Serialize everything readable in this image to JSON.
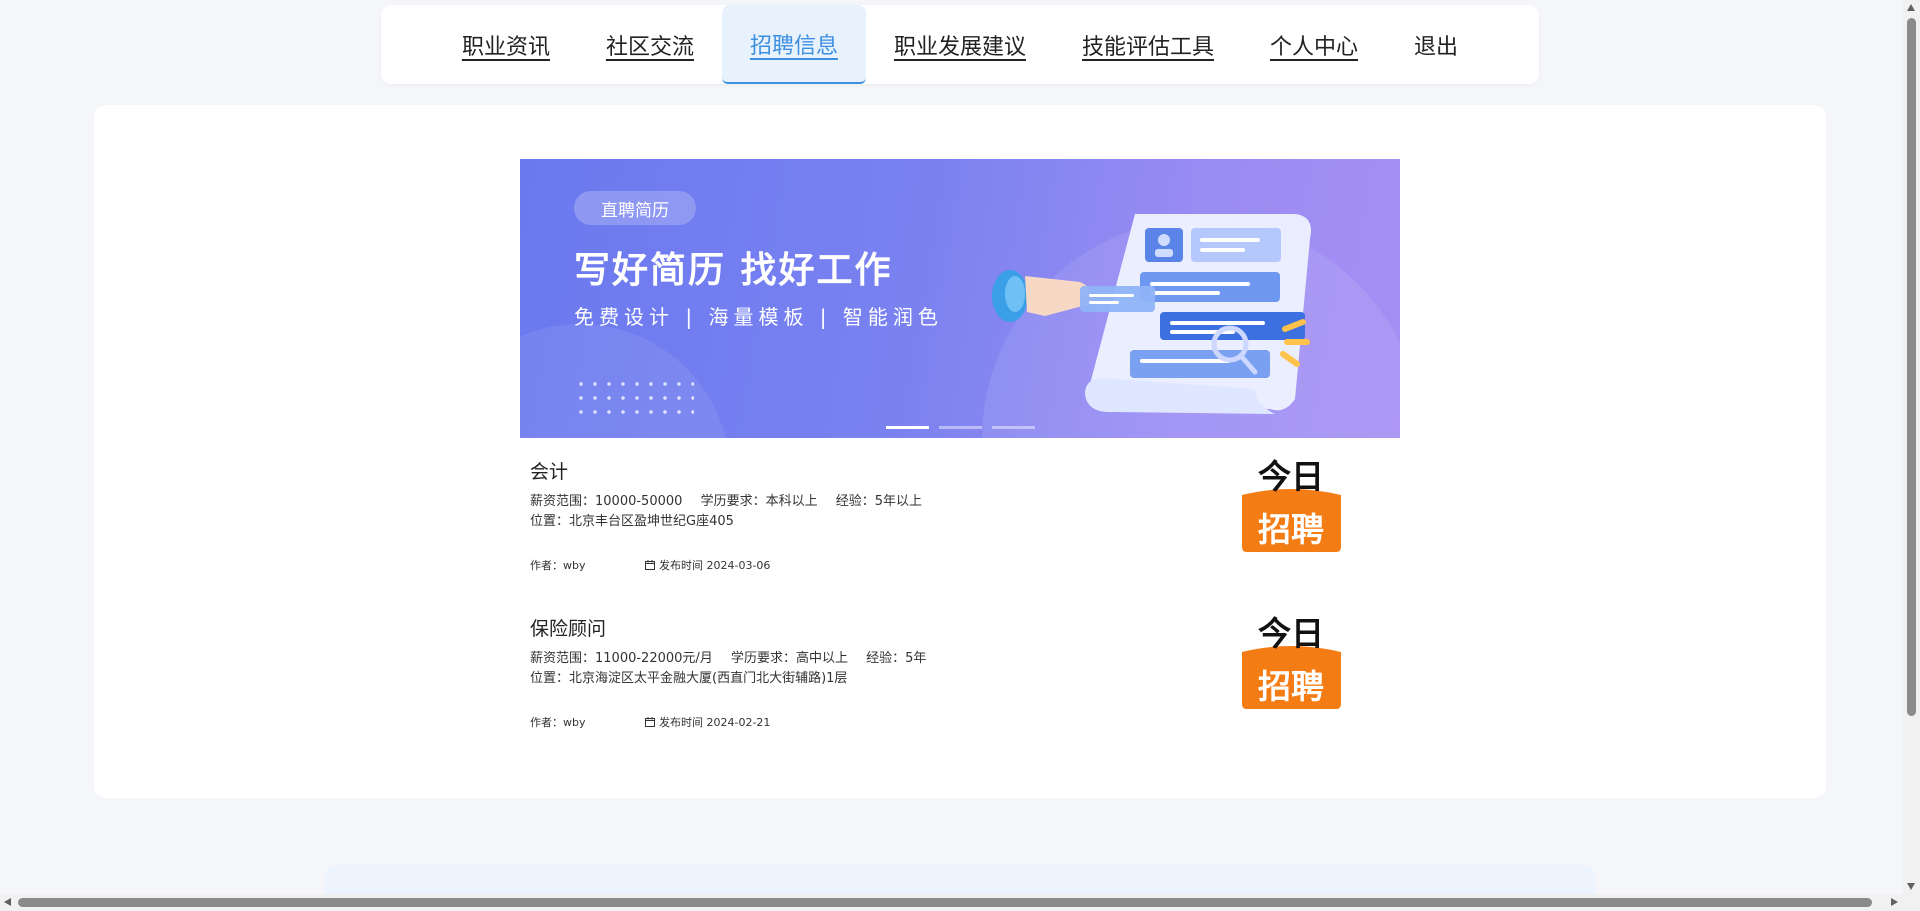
{
  "nav": {
    "items": [
      {
        "label": "职业资讯"
      },
      {
        "label": "社区交流"
      },
      {
        "label": "招聘信息"
      },
      {
        "label": "职业发展建议"
      },
      {
        "label": "技能评估工具"
      },
      {
        "label": "个人中心"
      },
      {
        "label": "退出"
      }
    ],
    "active_color": "#3d8fe0"
  },
  "banner": {
    "tag": "直聘简历",
    "headline": "写好简历 找好工作",
    "subline": "免费设计 | 海量模板 | 智能润色",
    "slide_count": 3,
    "active_slide": 1
  },
  "jobs": [
    {
      "title": "会计",
      "salary_label": "薪资范围：",
      "salary": "10000-50000",
      "education_label": "学历要求：",
      "education": "本科以上",
      "experience_label": "经验：",
      "experience": "5年以上",
      "location_label": "位置：",
      "location": "北京丰台区盈坤世纪G座405",
      "author_label": "作者：",
      "author": "wby",
      "date_label": "发布时间",
      "date": "2024-03-06",
      "logo": {
        "line1": "今日",
        "line2": "招聘"
      }
    },
    {
      "title": "保险顾问",
      "salary_label": "薪资范围：",
      "salary": "11000-22000元/月",
      "education_label": "学历要求：",
      "education": "高中以上",
      "experience_label": "经验：",
      "experience": "5年",
      "location_label": "位置：",
      "location": "北京海淀区太平金融大厦(西直门北大街辅路)1层",
      "author_label": "作者：",
      "author": "wby",
      "date_label": "发布时间",
      "date": "2024-02-21",
      "logo": {
        "line1": "今日",
        "line2": "招聘"
      }
    }
  ],
  "icons": {
    "calendar": "calendar-icon"
  },
  "colors": {
    "logo_orange": "#f47c15",
    "banner_start": "#6a79ef",
    "banner_end": "#a58ff4"
  }
}
